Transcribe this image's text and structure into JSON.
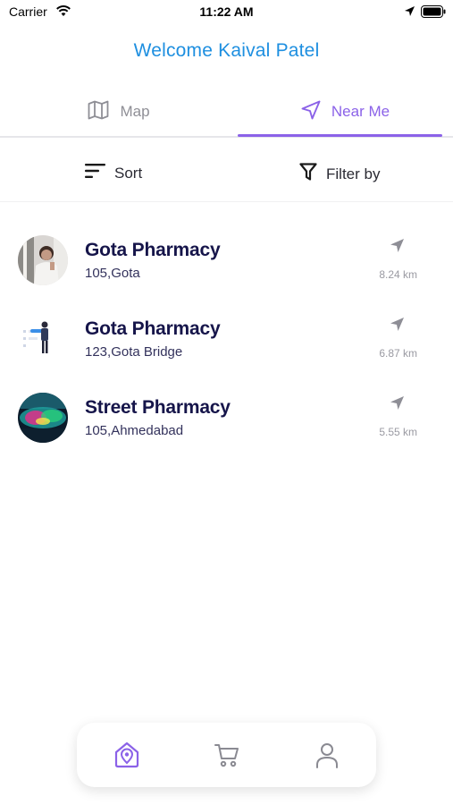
{
  "status": {
    "carrier": "Carrier",
    "time": "11:22 AM"
  },
  "header": {
    "welcome": "Welcome Kaival Patel"
  },
  "tabs": [
    {
      "label": "Map",
      "icon": "map-icon",
      "active": false
    },
    {
      "label": "Near Me",
      "icon": "navigation-icon",
      "active": true
    }
  ],
  "toolbar": {
    "sort_label": "Sort",
    "filter_label": "Filter by"
  },
  "pharmacies": [
    {
      "name": "Gota Pharmacy",
      "address": "105,Gota",
      "distance": "8.24 km"
    },
    {
      "name": "Gota Pharmacy",
      "address": "123,Gota Bridge",
      "distance": "6.87 km"
    },
    {
      "name": "Street Pharmacy",
      "address": "105,Ahmedabad",
      "distance": "5.55 km"
    }
  ],
  "bottom_nav": [
    {
      "icon": "home-location-icon",
      "active": true
    },
    {
      "icon": "cart-icon",
      "active": false
    },
    {
      "icon": "profile-icon",
      "active": false
    }
  ],
  "colors": {
    "accent": "#8b62e8",
    "welcome": "#1e8fe0",
    "text": "#16154a",
    "muted": "#9a9aa2"
  }
}
